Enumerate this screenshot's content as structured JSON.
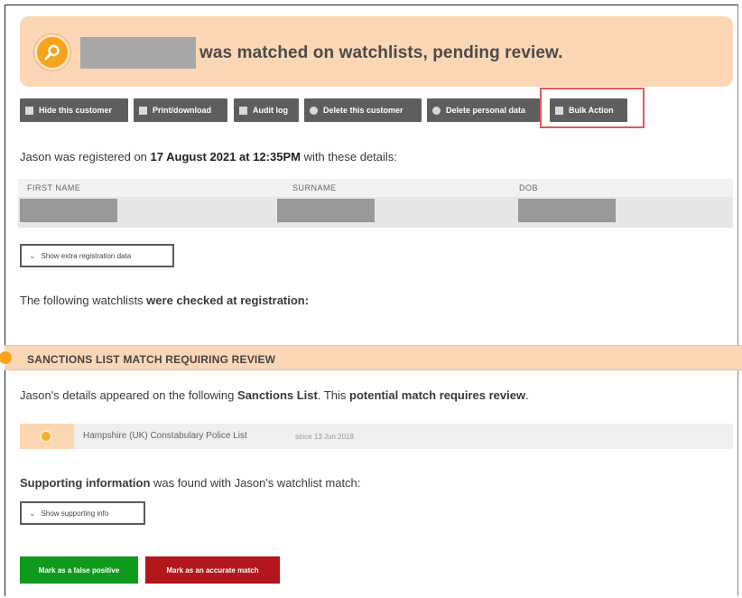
{
  "banner": {
    "icon": "search-icon",
    "status_text": "was matched on watchlists, pending review.",
    "icon_color": "#f7a41d",
    "background_color": "#fcd7b6"
  },
  "toolbar": {
    "buttons": [
      {
        "label": "Hide this customer",
        "icon": "hide-icon"
      },
      {
        "label": "Print/download",
        "icon": "print-icon"
      },
      {
        "label": "Audit log",
        "icon": "audit-log-icon"
      },
      {
        "label": "Delete this customer",
        "icon": "delete-customer-icon"
      },
      {
        "label": "Delete personal data",
        "icon": "delete-data-icon"
      },
      {
        "label": "Bulk Action",
        "icon": "bulk-action-icon"
      }
    ],
    "highlighted": "Bulk Action",
    "highlight_color": "#e8574f"
  },
  "registration": {
    "prefix": "Jason was registered on ",
    "date": "17 August 2021 at 12:35PM",
    "suffix": " with these details:"
  },
  "details_table": {
    "columns": [
      "FIRST NAME",
      "SURNAME",
      "DOB"
    ]
  },
  "extra_data_toggle": "Show extra registration data",
  "watchlists_text": {
    "prefix": "The following watchlists ",
    "bold": "were checked at registration:"
  },
  "sanctions": {
    "title": "SANCTIONS LIST MATCH REQUIRING REVIEW",
    "text_prefix": "Jason's details appeared on the following ",
    "text_bold1": "Sanctions List",
    "text_mid": ". This ",
    "text_bold2": "potential match requires review",
    "text_end": ".",
    "list_name": "Hampshire (UK) Constabulary Police List",
    "list_since": "since 13 Jun 2018"
  },
  "supporting": {
    "bold": "Supporting information",
    "rest": " was found with Jason's watchlist match:",
    "toggle": "Show supporting info"
  },
  "actions": {
    "false_positive": "Mark as a false positive",
    "accurate_match": "Mark as an accurate match",
    "green": "#0f9a1e",
    "red": "#b1171c"
  }
}
